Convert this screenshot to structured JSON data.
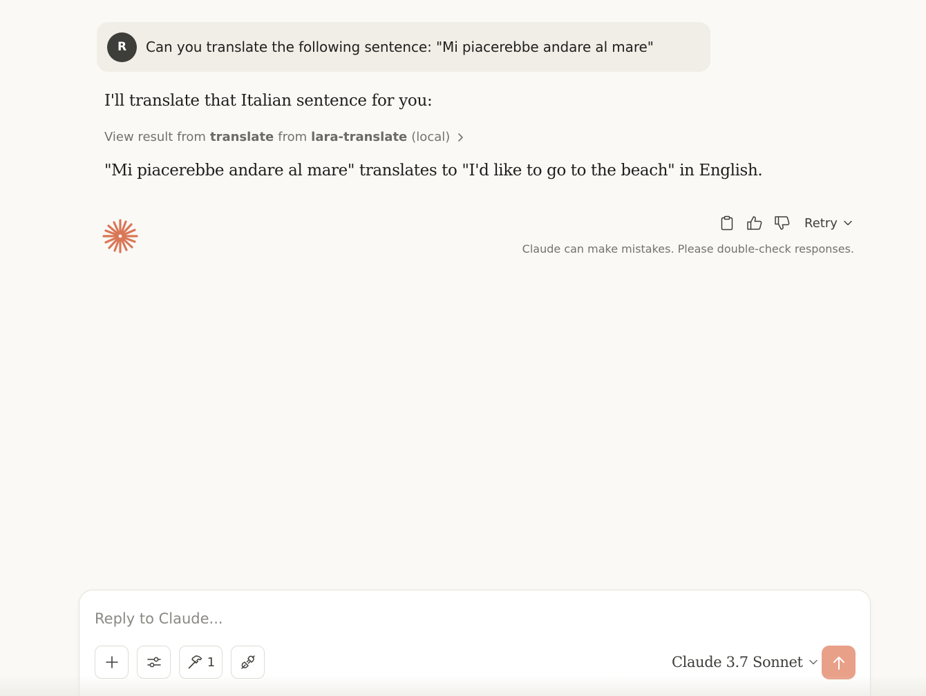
{
  "user_message": {
    "avatar_initial": "R",
    "text": "Can you translate the following sentence: \"Mi piacerebbe andare al mare\""
  },
  "response": {
    "intro": "I'll translate that Italian sentence for you:",
    "tool_result": {
      "prefix": "View result from",
      "tool_name": "translate",
      "middle": "from",
      "server_name": "lara-translate",
      "suffix": "(local)"
    },
    "body": "\"Mi piacerebbe andare al mare\" translates to \"I'd like to go to the beach\" in English."
  },
  "actions": {
    "copy_icon": "clipboard-icon",
    "thumbs_up_icon": "thumbs-up-icon",
    "thumbs_down_icon": "thumbs-down-icon",
    "retry_label": "Retry",
    "disclaimer": "Claude can make mistakes. Please double-check responses."
  },
  "composer": {
    "placeholder": "Reply to Claude...",
    "tools_count": "1",
    "model_name": "Claude 3.7 Sonnet"
  },
  "colors": {
    "background": "#faf9f5",
    "user_bubble": "#f0eee6",
    "avatar": "#3d3d3a",
    "brand_spark": "#d97757",
    "send_button": "#e9a089"
  }
}
